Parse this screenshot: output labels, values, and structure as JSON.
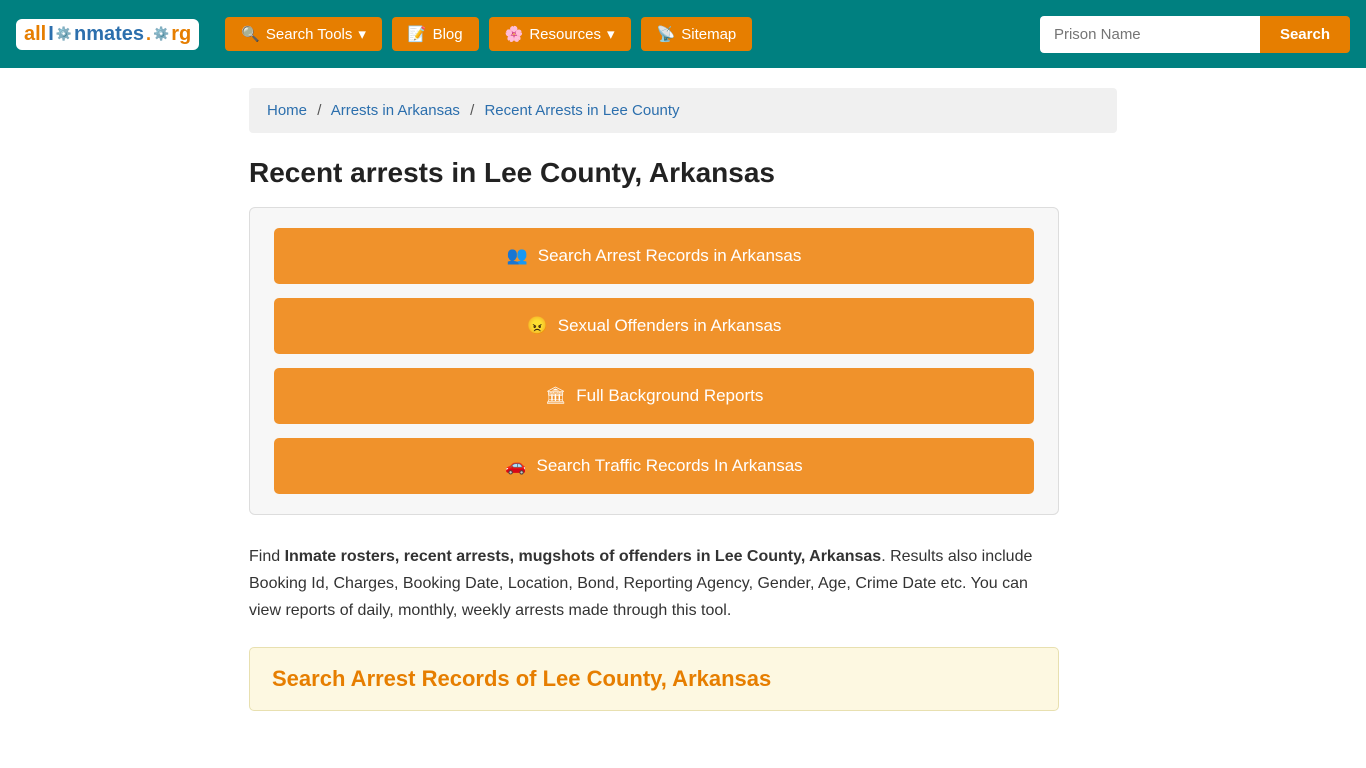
{
  "navbar": {
    "logo": {
      "all": "all",
      "inmates": "Inmates",
      "org": ".org"
    },
    "nav_items": [
      {
        "id": "search-tools",
        "label": "Search Tools",
        "icon": "🔍",
        "has_dropdown": true
      },
      {
        "id": "blog",
        "label": "Blog",
        "icon": "📝",
        "has_dropdown": false
      },
      {
        "id": "resources",
        "label": "Resources",
        "icon": "🌸",
        "has_dropdown": true
      },
      {
        "id": "sitemap",
        "label": "Sitemap",
        "icon": "📡",
        "has_dropdown": false
      }
    ],
    "prison_input_placeholder": "Prison Name",
    "search_button_label": "Search"
  },
  "breadcrumb": {
    "home_label": "Home",
    "arrests_label": "Arrests in Arkansas",
    "current_label": "Recent Arrests in Lee County"
  },
  "page": {
    "title": "Recent arrests in Lee County, Arkansas",
    "buttons": [
      {
        "id": "search-arrest",
        "icon": "👥",
        "label": "Search Arrest Records in Arkansas"
      },
      {
        "id": "sexual-offenders",
        "icon": "😠",
        "label": "Sexual Offenders in Arkansas"
      },
      {
        "id": "background-reports",
        "icon": "🏛",
        "label": "Full Background Reports"
      },
      {
        "id": "traffic-records",
        "icon": "🚗",
        "label": "Search Traffic Records In Arkansas"
      }
    ],
    "description_part1": "Find ",
    "description_bold": "Inmate rosters, recent arrests, mugshots of offenders in Lee County, Arkansas",
    "description_part2": ". Results also include Booking Id, Charges, Booking Date, Location, Bond, Reporting Agency, Gender, Age, Crime Date etc. You can view reports of daily, monthly, weekly arrests made through this tool.",
    "section_heading": "Search Arrest Records of Lee County, Arkansas"
  }
}
